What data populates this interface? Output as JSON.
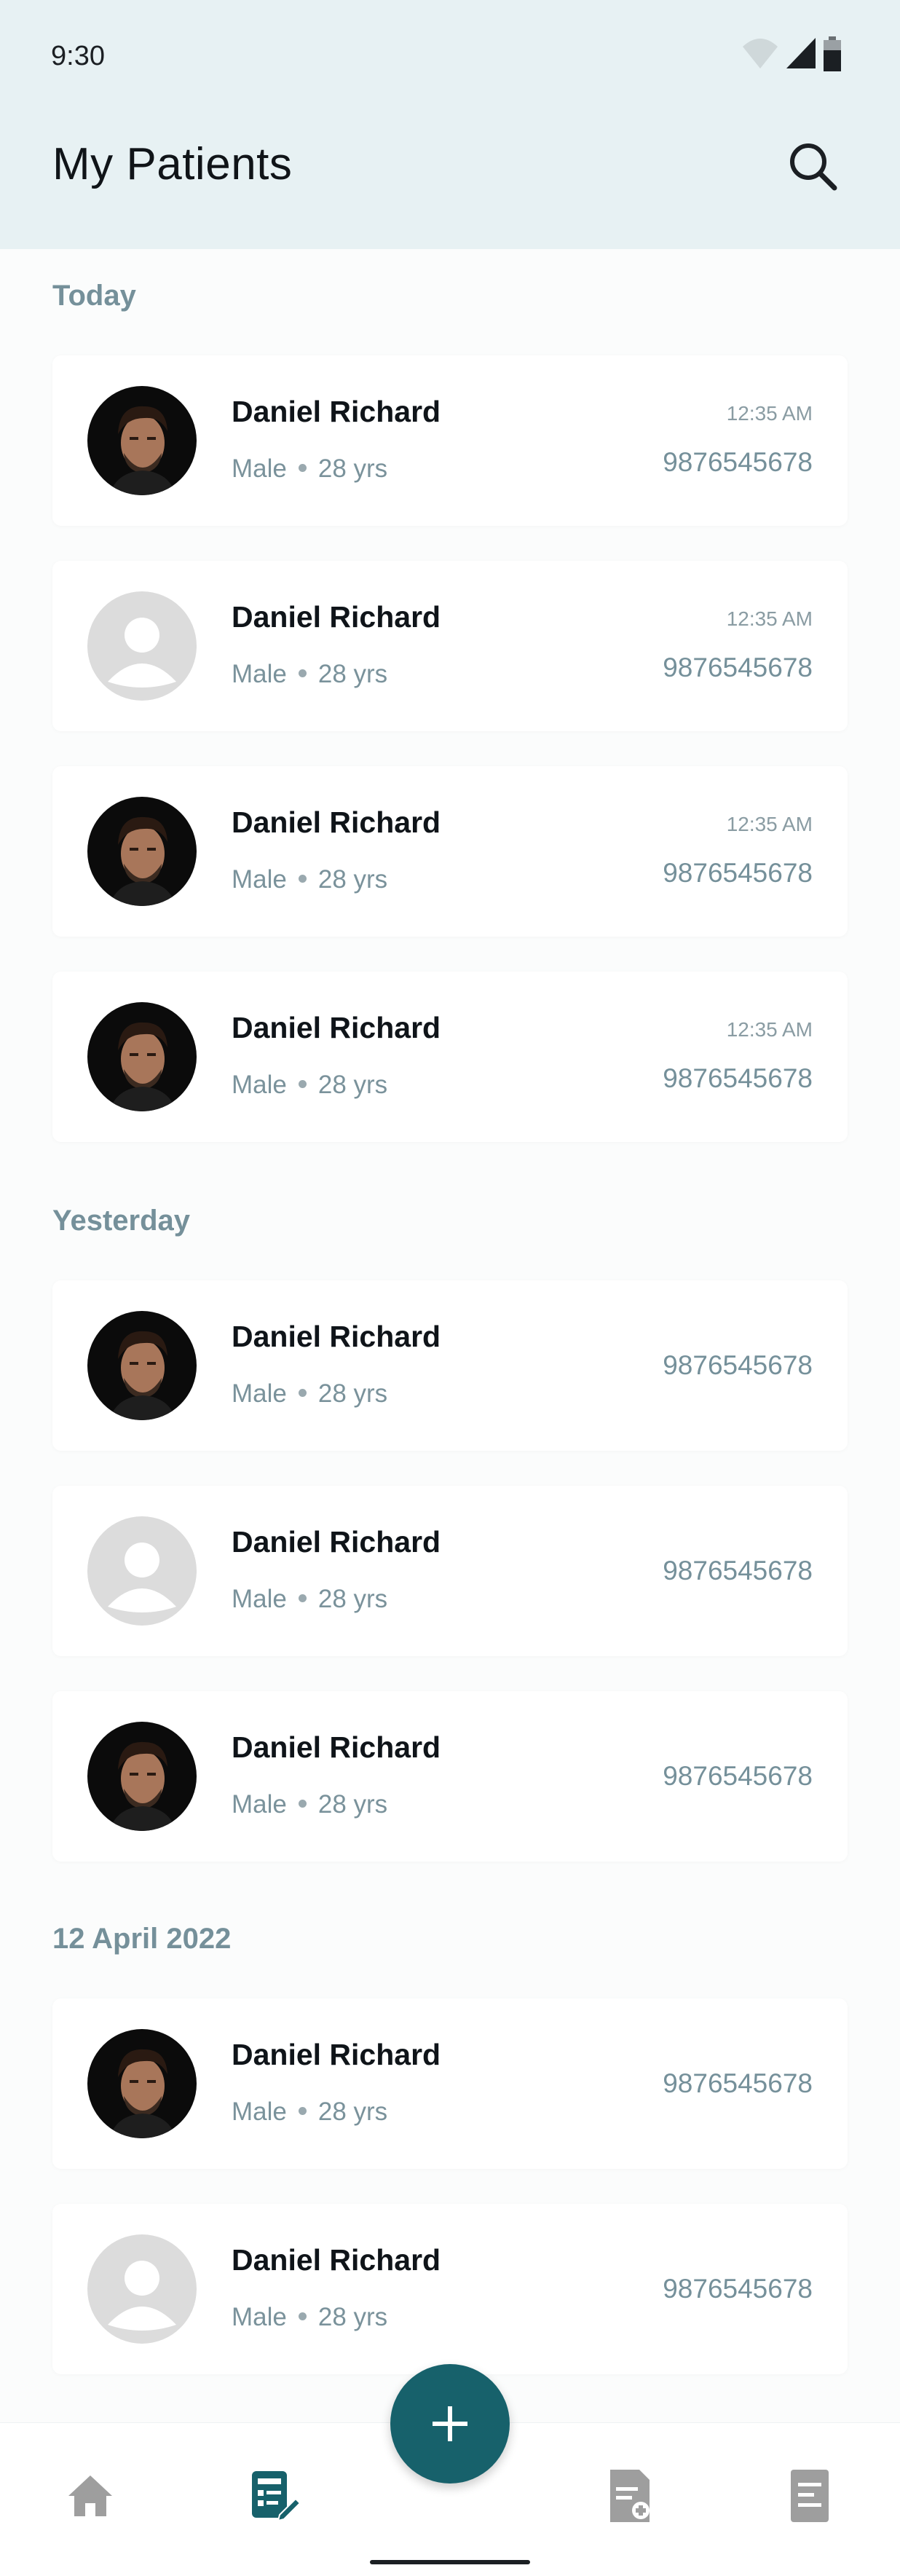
{
  "status_bar": {
    "time": "9:30"
  },
  "header": {
    "title": "My Patients"
  },
  "sections": [
    {
      "label": "Today",
      "patients": [
        {
          "name": "Daniel Richard",
          "gender": "Male",
          "age": "28 yrs",
          "time": "12:35 AM",
          "phone": "9876545678",
          "avatar": "photo"
        },
        {
          "name": "Daniel Richard",
          "gender": "Male",
          "age": "28 yrs",
          "time": "12:35 AM",
          "phone": "9876545678",
          "avatar": "placeholder"
        },
        {
          "name": "Daniel Richard",
          "gender": "Male",
          "age": "28 yrs",
          "time": "12:35 AM",
          "phone": "9876545678",
          "avatar": "photo"
        },
        {
          "name": "Daniel Richard",
          "gender": "Male",
          "age": "28 yrs",
          "time": "12:35 AM",
          "phone": "9876545678",
          "avatar": "photo"
        }
      ]
    },
    {
      "label": "Yesterday",
      "patients": [
        {
          "name": "Daniel Richard",
          "gender": "Male",
          "age": "28 yrs",
          "phone": "9876545678",
          "avatar": "photo"
        },
        {
          "name": "Daniel Richard",
          "gender": "Male",
          "age": "28 yrs",
          "phone": "9876545678",
          "avatar": "placeholder"
        },
        {
          "name": "Daniel Richard",
          "gender": "Male",
          "age": "28 yrs",
          "phone": "9876545678",
          "avatar": "photo"
        }
      ]
    },
    {
      "label": "12 April 2022",
      "patients": [
        {
          "name": "Daniel Richard",
          "gender": "Male",
          "age": "28 yrs",
          "phone": "9876545678",
          "avatar": "photo"
        },
        {
          "name": "Daniel Richard",
          "gender": "Male",
          "age": "28 yrs",
          "phone": "9876545678",
          "avatar": "placeholder"
        }
      ]
    }
  ],
  "bottom_nav": [
    {
      "icon": "home-icon",
      "active": false
    },
    {
      "icon": "patients-icon",
      "active": true
    },
    {
      "icon": "add-report-icon",
      "active": false
    },
    {
      "icon": "document-icon",
      "active": false
    }
  ],
  "colors": {
    "header_bg": "#e7f1f3",
    "accent": "#17616b",
    "muted_text": "#75909a",
    "inactive_icon": "#9e9e9e"
  }
}
